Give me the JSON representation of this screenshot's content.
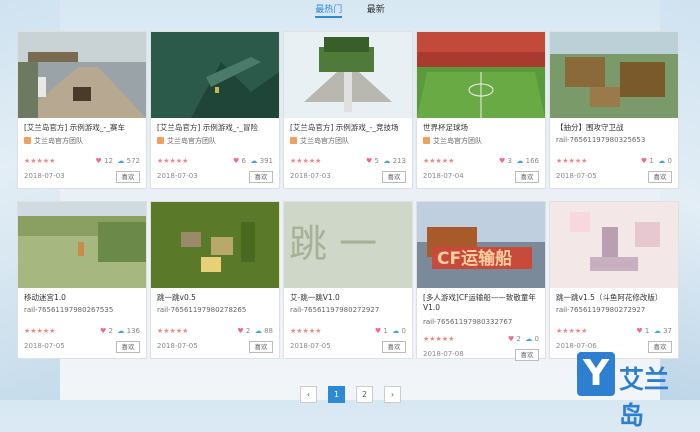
{
  "tabs": [
    {
      "label": "最热门",
      "active": true
    },
    {
      "label": "最新",
      "active": false
    }
  ],
  "cards": [
    {
      "title": "[艾兰岛官方] 示例游戏_-_赛车",
      "author": "艾兰岛官方团队",
      "likes": "12",
      "downloads": "572",
      "date": "2018-07-03",
      "thumb": "race"
    },
    {
      "title": "[艾兰岛官方] 示例游戏_-_冒险",
      "author": "艾兰岛官方团队",
      "likes": "6",
      "downloads": "391",
      "date": "2018-07-03",
      "thumb": "adventure"
    },
    {
      "title": "[艾兰岛官方] 示例游戏_-_竞技场",
      "author": "艾兰岛官方团队",
      "likes": "5",
      "downloads": "213",
      "date": "2018-07-03",
      "thumb": "arena"
    },
    {
      "title": "世界杯足球场",
      "author": "艾兰岛官方团队",
      "likes": "3",
      "downloads": "166",
      "date": "2018-07-04",
      "thumb": "soccer"
    },
    {
      "title": "【抽分】围攻守卫战",
      "author": "rail-76561197980325653",
      "likes": "1",
      "downloads": "0",
      "date": "2018-07-05",
      "thumb": "siege"
    },
    {
      "title": "移动迷宫1.0",
      "author": "rail-76561197980267535",
      "likes": "2",
      "downloads": "136",
      "date": "2018-07-05",
      "thumb": "maze"
    },
    {
      "title": "跳一跳v0.5",
      "author": "rail-76561197980278265",
      "likes": "2",
      "downloads": "88",
      "date": "2018-07-05",
      "thumb": "jump05"
    },
    {
      "title": "艾-跳一跳V1.0",
      "author": "rail-76561197980272927",
      "likes": "1",
      "downloads": "0",
      "date": "2018-07-05",
      "thumb": "jump10"
    },
    {
      "title": "[多人游戏]CF运输船——致敬童年V1.0",
      "author": "rail-76561197980332767",
      "likes": "2",
      "downloads": "0",
      "date": "2018-07-08",
      "thumb": "cf"
    },
    {
      "title": "跳一跳v1.5（斗鱼阿花修改版）",
      "author": "rail-76561197980272927",
      "likes": "1",
      "downloads": "37",
      "date": "2018-07-06",
      "thumb": "jump15"
    }
  ],
  "card_common": {
    "stars": "★★★★★",
    "like_label": "喜欢"
  },
  "pagination": {
    "prev": "‹",
    "pages": [
      "1",
      "2"
    ],
    "next": "›",
    "current": "1"
  },
  "logo": {
    "letter": "Y",
    "text": "艾兰岛"
  },
  "colors": {
    "accent": "#2d8ad6",
    "heart": "#f06a93",
    "cloud": "#4aa3d6"
  }
}
